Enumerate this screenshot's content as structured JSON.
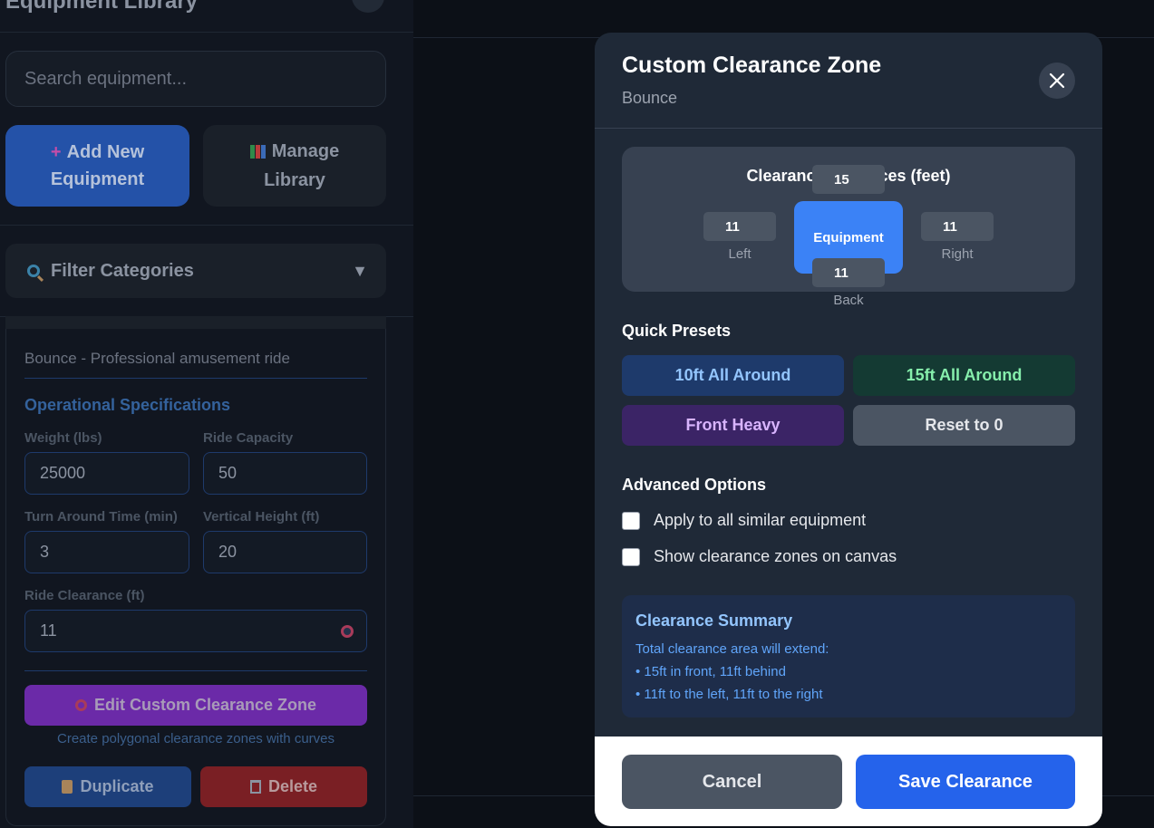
{
  "sidebar": {
    "title": "Equipment Library",
    "search_placeholder": "Search equipment...",
    "add_button": "Add New Equipment",
    "manage_button": "Manage Library",
    "filter_label": "Filter Categories",
    "filter_caret": "▼",
    "card": {
      "description": "Bounce - Professional amusement ride",
      "spec_title": "Operational Specifications",
      "fields": {
        "weight_label": "Weight (lbs)",
        "weight_value": "25000",
        "capacity_label": "Ride Capacity",
        "capacity_value": "50",
        "turnaround_label": "Turn Around Time (min)",
        "turnaround_value": "3",
        "height_label": "Vertical Height (ft)",
        "height_value": "20",
        "clearance_label": "Ride Clearance (ft)",
        "clearance_value": "11"
      },
      "edit_zone_button": "Edit Custom Clearance Zone",
      "edit_zone_hint": "Create polygonal clearance zones with curves",
      "duplicate_button": "Duplicate",
      "delete_button": "Delete"
    }
  },
  "modal": {
    "title": "Custom Clearance Zone",
    "subtitle": "Bounce",
    "clearance": {
      "title": "Clearance Distances (feet)",
      "front": "15",
      "left": "11",
      "right": "11",
      "back": "11",
      "left_label": "Left",
      "right_label": "Right",
      "back_label": "Back",
      "equipment_label": "Equipment"
    },
    "quick_presets_title": "Quick Presets",
    "presets": [
      "10ft All Around",
      "15ft All Around",
      "Front Heavy",
      "Reset to 0"
    ],
    "advanced_title": "Advanced Options",
    "options": [
      "Apply to all similar equipment",
      "Show clearance zones on canvas"
    ],
    "summary": {
      "title": "Clearance Summary",
      "intro": "Total clearance area will extend:",
      "line1": "• 15ft in front, 11ft behind",
      "line2": "• 11ft to the left, 11ft to the right"
    },
    "cancel_button": "Cancel",
    "save_button": "Save Clearance"
  },
  "colors": {
    "accent_blue": "#2563eb",
    "equipment_blue": "#3b82f6",
    "modal_bg": "#1f2937",
    "purple": "#6b2aa8",
    "danger": "#7a1f24"
  }
}
